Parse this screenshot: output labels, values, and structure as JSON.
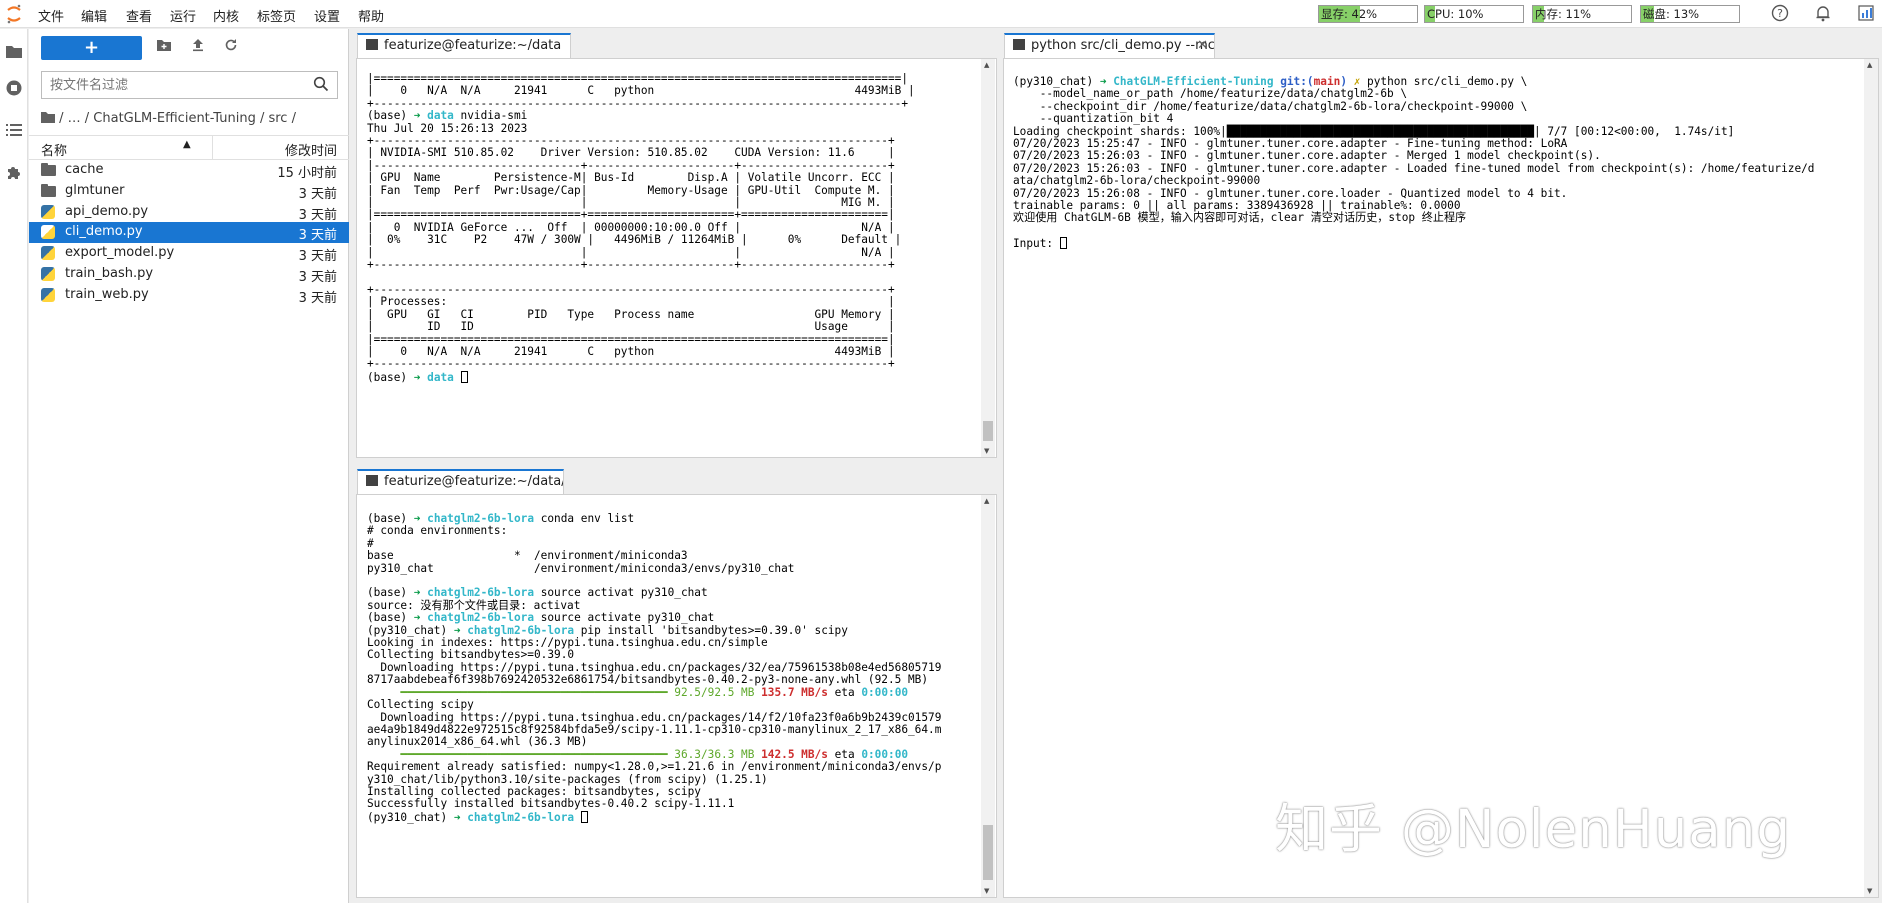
{
  "menubar": {
    "items": [
      "文件",
      "编辑",
      "查看",
      "运行",
      "内核",
      "标签页",
      "设置",
      "帮助"
    ],
    "meters": {
      "gpu_mem": "显存: 42%",
      "cpu": "CPU: 10%",
      "mem": "内存: 11%",
      "disk": "磁盘: 13%"
    },
    "meter_levels": {
      "gpu_mem": 0.42,
      "cpu": 0.1,
      "mem": 0.11,
      "disk": 0.13
    }
  },
  "filebrowser": {
    "filter_placeholder": "按文件名过滤",
    "breadcrumb": "/  …  / ChatGLM-Efficient-Tuning / src /",
    "col_name": "名称",
    "col_modified": "修改时间",
    "files": [
      {
        "name": "cache",
        "type": "folder",
        "modified": "15 小时前"
      },
      {
        "name": "glmtuner",
        "type": "folder",
        "modified": "3 天前"
      },
      {
        "name": "api_demo.py",
        "type": "python",
        "modified": "3 天前"
      },
      {
        "name": "cli_demo.py",
        "type": "python",
        "modified": "3 天前",
        "selected": true
      },
      {
        "name": "export_model.py",
        "type": "python",
        "modified": "3 天前"
      },
      {
        "name": "train_bash.py",
        "type": "python",
        "modified": "3 天前"
      },
      {
        "name": "train_web.py",
        "type": "python",
        "modified": "3 天前"
      }
    ]
  },
  "tabs": {
    "term1": "featurize@featurize:~/data",
    "term2": "featurize@featurize:~/data/c",
    "term3": "python src/cli_demo.py --mc"
  },
  "terminal1": [
    "|===============================================================================|",
    "|    0   N/A  N/A     21941      C   python                              4493MiB |",
    "+-------------------------------------------------------------------------------+",
    "(base) ➜ data nvidia-smi",
    "Thu Jul 20 15:26:13 2023",
    "+-----------------------------------------------------------------------------+",
    "| NVIDIA-SMI 510.85.02    Driver Version: 510.85.02    CUDA Version: 11.6     |",
    "|-------------------------------+----------------------+----------------------+",
    "| GPU  Name        Persistence-M| Bus-Id        Disp.A | Volatile Uncorr. ECC |",
    "| Fan  Temp  Perf  Pwr:Usage/Cap|         Memory-Usage | GPU-Util  Compute M. |",
    "|                               |                      |               MIG M. |",
    "|===============================+======================+======================|",
    "|   0  NVIDIA GeForce ...  Off  | 00000000:10:00.0 Off |                  N/A |",
    "|  0%    31C    P2    47W / 300W |   4496MiB / 11264MiB |      0%      Default |",
    "|                               |                      |                  N/A |",
    "+-------------------------------+----------------------+----------------------+",
    "",
    "+-----------------------------------------------------------------------------+",
    "| Processes:                                                                  |",
    "|  GPU   GI   CI        PID   Type   Process name                  GPU Memory |",
    "|        ID   ID                                                   Usage      |",
    "|=============================================================================|",
    "|    0   N/A  N/A     21941      C   python                           4493MiB |",
    "+-----------------------------------------------------------------------------+",
    "(base) ➜ data "
  ],
  "terminal2": [
    "(base) ➜ chatglm2-6b-lora conda env list",
    "# conda environments:",
    "#",
    "base                  *  /environment/miniconda3",
    "py310_chat               /environment/miniconda3/envs/py310_chat",
    "",
    "(base) ➜ chatglm2-6b-lora source activat py310_chat",
    "source: 没有那个文件或目录: activat",
    "(base) ➜ chatglm2-6b-lora source activate py310_chat",
    "(py310_chat) ➜ chatglm2-6b-lora pip install 'bitsandbytes>=0.39.0' scipy",
    "Looking in indexes: https://pypi.tuna.tsinghua.edu.cn/simple",
    "Collecting bitsandbytes>=0.39.0",
    "  Downloading https://pypi.tuna.tsinghua.edu.cn/packages/32/ea/75961538b08e4ed56805719",
    "8717aabdebeaf6f398b7692420532e6861754/bitsandbytes-0.40.2-py3-none-any.whl (92.5 MB)",
    "     ━━━━━━━━━━━━━━━━━━━━━━━━━━━━━━━━━━━━━━━━ 92.5/92.5 MB 135.7 MB/s eta 0:00:00",
    "Collecting scipy",
    "  Downloading https://pypi.tuna.tsinghua.edu.cn/packages/14/f2/10fa23f0a6b9b2439c01579",
    "ae4a9b1849d4822e972515c8f92584bfda5e9/scipy-1.11.1-cp310-cp310-manylinux_2_17_x86_64.m",
    "anylinux2014_x86_64.whl (36.3 MB)",
    "     ━━━━━━━━━━━━━━━━━━━━━━━━━━━━━━━━━━━━━━━━ 36.3/36.3 MB 142.5 MB/s eta 0:00:00",
    "Requirement already satisfied: numpy<1.28.0,>=1.21.6 in /environment/miniconda3/envs/p",
    "y310_chat/lib/python3.10/site-packages (from scipy) (1.25.1)",
    "Installing collected packages: bitsandbytes, scipy",
    "Successfully installed bitsandbytes-0.40.2 scipy-1.11.1",
    "(py310_chat) ➜ chatglm2-6b-lora "
  ],
  "terminal3": [
    "(py310_chat) ➜ ChatGLM-Efficient-Tuning git:(main) ✗ python src/cli_demo.py \\",
    "    --model_name_or_path /home/featurize/data/chatglm2-6b \\",
    "    --checkpoint_dir /home/featurize/data/chatglm2-6b-lora/checkpoint-99000 \\",
    "    --quantization_bit 4",
    "Loading checkpoint shards: 100%|██████████████████████████████████████████████| 7/7 [00:12<00:00,  1.74s/it]",
    "07/20/2023 15:25:47 - INFO - glmtuner.tuner.core.adapter - Fine-tuning method: LoRA",
    "07/20/2023 15:26:03 - INFO - glmtuner.tuner.core.adapter - Merged 1 model checkpoint(s).",
    "07/20/2023 15:26:03 - INFO - glmtuner.tuner.core.adapter - Loaded fine-tuned model from checkpoint(s): /home/featurize/d",
    "ata/chatglm2-6b-lora/checkpoint-99000",
    "07/20/2023 15:26:08 - INFO - glmtuner.tuner.core.loader - Quantized model to 4 bit.",
    "trainable params: 0 || all params: 3389436928 || trainable%: 0.0000",
    "欢迎使用 ChatGLM-6B 模型，输入内容即可对话，clear 清空对话历史，stop 终止程序",
    "",
    "Input: "
  ],
  "watermark": "知乎 @NolenHuang"
}
